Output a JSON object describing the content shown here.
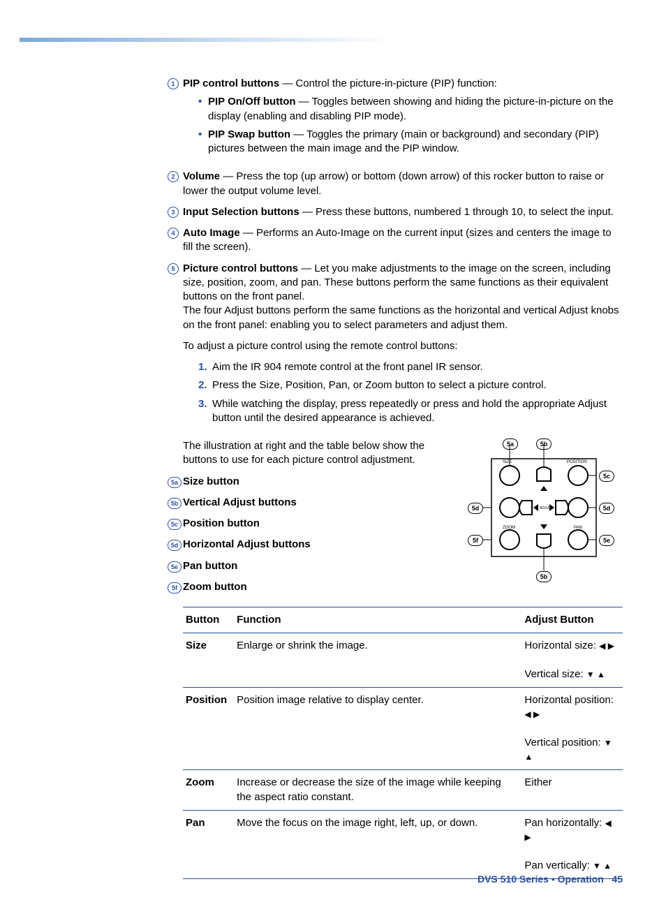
{
  "items": {
    "i1": {
      "title": "PIP control buttons",
      "desc": " — Control the picture-in-picture (PIP) function:"
    },
    "i1a": {
      "title": "PIP On/Off button",
      "desc": " — Toggles between showing and hiding the picture-in-picture on the display (enabling and disabling PIP mode)."
    },
    "i1b": {
      "title": "PIP Swap button",
      "desc": " — Toggles the primary (main or background) and secondary (PIP) pictures between the main image and the PIP window."
    },
    "i2": {
      "title": "Volume",
      "desc": " — Press the top (up arrow) or bottom (down arrow) of this rocker button to raise or lower the output volume level."
    },
    "i3": {
      "title": "Input Selection buttons",
      "desc": " — Press these buttons, numbered 1 through 10, to select the input."
    },
    "i4": {
      "title": "Auto Image",
      "desc": " — Performs an Auto-Image on the current input (sizes and centers the image to fill the screen)."
    },
    "i5": {
      "title": "Picture control buttons",
      "desc": " — Let you make adjustments to the image on the screen, including size, position, zoom, and pan. These buttons perform the same functions as their equivalent buttons on the front panel."
    }
  },
  "p1": "The four Adjust buttons perform the same functions as the horizontal and vertical Adjust knobs on the front panel: enabling you to select parameters and adjust them.",
  "p2": "To adjust a picture control using the remote control buttons:",
  "steps": {
    "s1": "Aim the IR 904 remote control at the front panel IR sensor.",
    "s2": "Press the Size, Position, Pan, or Zoom button to select a picture control.",
    "s3": "While watching the display, press repeatedly or press and hold the appropriate Adjust button until the desired appearance is achieved."
  },
  "p3": "The illustration at right and the table below show the buttons to use for each picture control adjustment.",
  "sub": {
    "a": "Size button",
    "b": "Vertical Adjust buttons",
    "c": "Position button",
    "d": "Horizontal Adjust buttons",
    "e": "Pan button",
    "f": "Zoom button"
  },
  "diag": {
    "size": "SIZE",
    "position": "POSITION",
    "zoom": "ZOOM",
    "pan": "PAN",
    "adjust": "ADJUST"
  },
  "table": {
    "h1": "Button",
    "h2": "Function",
    "h3": "Adjust Button",
    "r1": {
      "b": "Size",
      "f": "Enlarge or shrink the image.",
      "a1": "Horizontal size: ",
      "a2": "Vertical size: "
    },
    "r2": {
      "b": "Position",
      "f": "Position image relative to display center.",
      "a1": "Horizontal position: ",
      "a2": "Vertical position: "
    },
    "r3": {
      "b": "Zoom",
      "f": "Increase or decrease the size of the image while keeping the aspect ratio constant.",
      "a1": "Either"
    },
    "r4": {
      "b": "Pan",
      "f": "Move the focus on the image right, left, up, or down.",
      "a1": "Pan horizontally: ",
      "a2": "Pan vertically: "
    }
  },
  "arrows": {
    "lr": "◀  ▶",
    "ud": "▼  ▲"
  },
  "footer": {
    "title": "DVS 510 Series • Operation",
    "page": "45"
  }
}
